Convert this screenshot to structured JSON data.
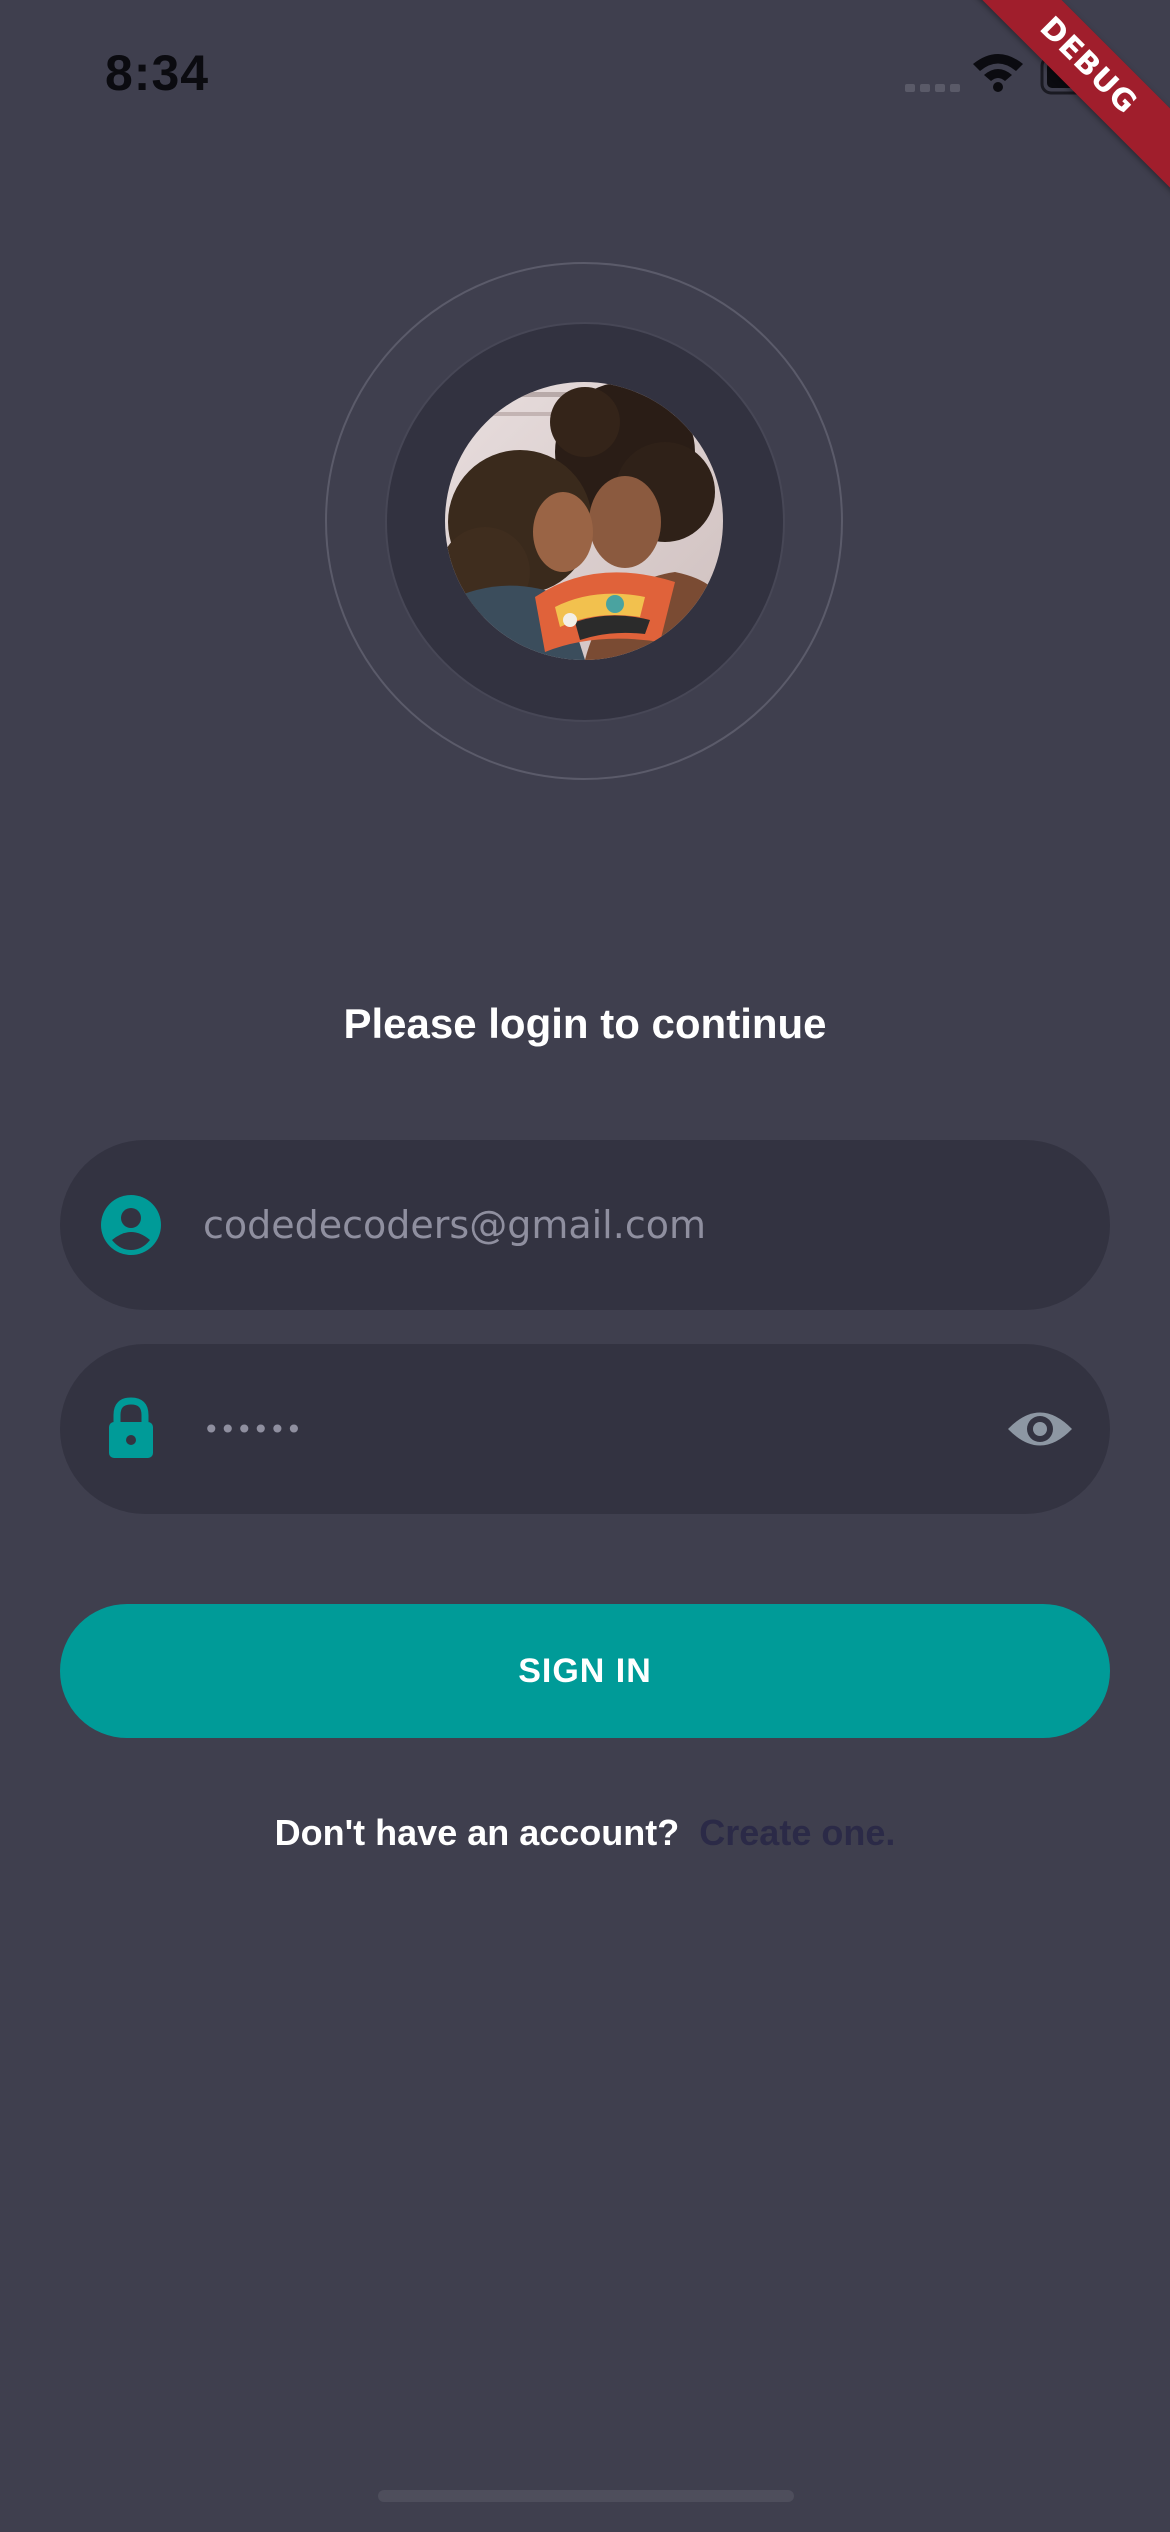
{
  "status_bar": {
    "time": "8:34",
    "signal_icon": "cellular-signal-icon",
    "wifi_icon": "wifi-icon",
    "battery_icon": "battery-icon"
  },
  "debug_banner": "DEBUG",
  "avatar": {
    "icon": "profile-photo"
  },
  "login": {
    "heading": "Please login to continue",
    "email": {
      "icon": "user-icon",
      "value": "codedecoders@gmail.com"
    },
    "password": {
      "icon": "lock-icon",
      "value": "******",
      "toggle_icon": "eye-icon"
    },
    "sign_in_label": "SIGN IN",
    "signup_question": "Don't have an account?",
    "signup_link": "Create one."
  },
  "colors": {
    "background": "#3f3f4e",
    "field_background": "#333341",
    "accent": "#009b98",
    "link": "#2b2a47",
    "debug_ribbon": "#a01e2c"
  }
}
